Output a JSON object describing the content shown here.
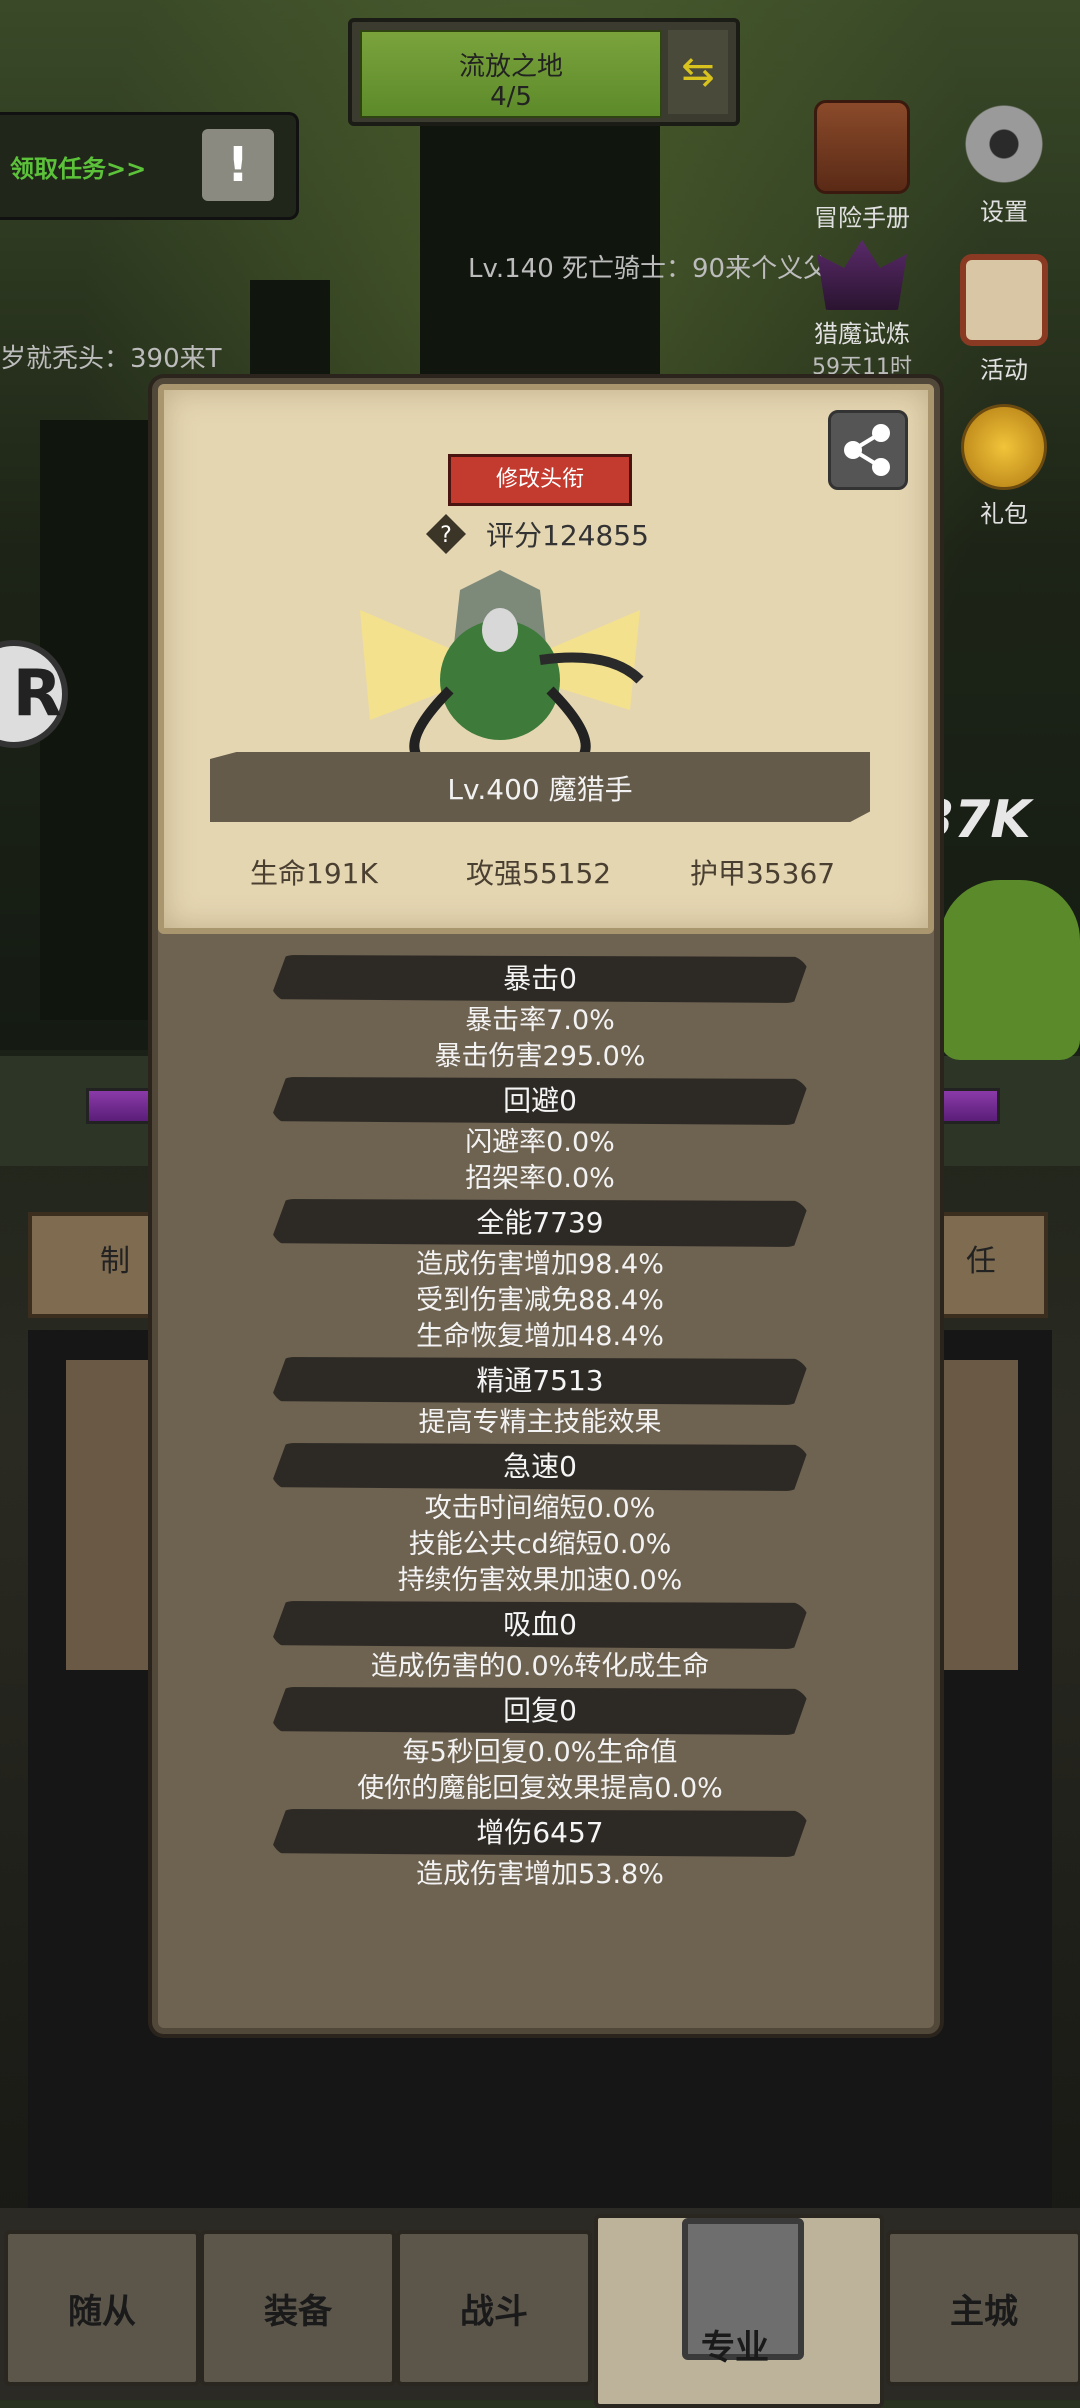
{
  "stage": {
    "name": "流放之地",
    "progress": "4/5",
    "switch_icon": "swap-icon"
  },
  "quest": {
    "label": "领取任务>>",
    "icon": "exclamation-icon"
  },
  "boss_line": "Lv.140 死亡骑士：90来个义父",
  "left_line": "岁就秃头：390来T",
  "side_icons": [
    {
      "label": "冒险手册",
      "icon": "book-icon"
    },
    {
      "label": "设置",
      "icon": "gear-icon"
    },
    {
      "label": "猎魔试炼",
      "icon": "demon-trial-icon"
    },
    {
      "label": "活动",
      "icon": "calendar-icon"
    },
    {
      "label": "礼包",
      "icon": "gift-icon"
    }
  ],
  "trial_timer": "59天11时",
  "r_badge": "R",
  "damage_text": "37K",
  "mid_tabs": {
    "left": "制",
    "right": "任"
  },
  "profile": {
    "change_title_button": "修改头衔",
    "score": "评分124855",
    "name": "Lv.400 魔猎手",
    "hp": "生命191K",
    "attack": "攻强55152",
    "armor": "护甲35367"
  },
  "stat_groups": [
    {
      "title": "暴击0",
      "lines": [
        "暴击率7.0%",
        "暴击伤害295.0%"
      ]
    },
    {
      "title": "回避0",
      "lines": [
        "闪避率0.0%",
        "招架率0.0%"
      ]
    },
    {
      "title": "全能7739",
      "lines": [
        "造成伤害增加98.4%",
        "受到伤害减免88.4%",
        "生命恢复增加48.4%"
      ]
    },
    {
      "title": "精通7513",
      "lines": [
        "提高专精主技能效果"
      ]
    },
    {
      "title": "急速0",
      "lines": [
        "攻击时间缩短0.0%",
        "技能公共cd缩短0.0%",
        "持续伤害效果加速0.0%"
      ]
    },
    {
      "title": "吸血0",
      "lines": [
        "造成伤害的0.0%转化成生命"
      ]
    },
    {
      "title": "回复0",
      "lines": [
        "每5秒回复0.0%生命值",
        "使你的魔能回复效果提高0.0%"
      ]
    },
    {
      "title": "增伤6457",
      "lines": [
        "造成伤害增加53.8%"
      ]
    }
  ],
  "nav": [
    "随从",
    "装备",
    "战斗",
    "专业",
    "主城"
  ]
}
